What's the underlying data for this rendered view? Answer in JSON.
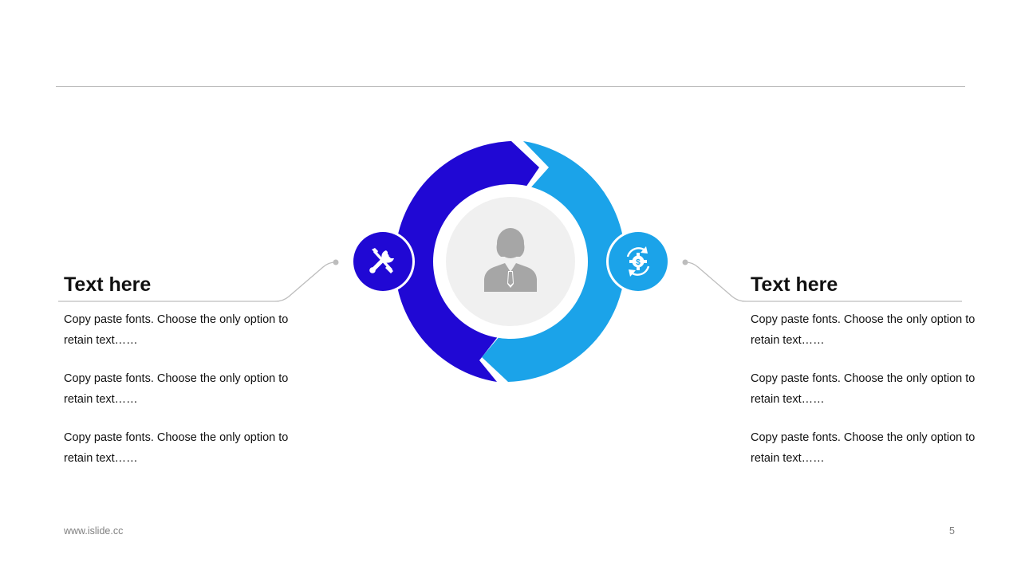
{
  "colors": {
    "dark_blue": "#2008d4",
    "light_blue": "#1ba3e9",
    "center_fill": "#f0f0f0",
    "person_icon": "#a6a6a6",
    "rule": "#bdbdbd"
  },
  "left_panel": {
    "title": "Text here",
    "paragraphs": [
      "Copy paste fonts. Choose the only option to retain text……",
      "Copy paste fonts. Choose the only option to retain text……",
      "Copy paste fonts. Choose the only option to retain text……"
    ],
    "icon": "tools-icon"
  },
  "right_panel": {
    "title": "Text here",
    "paragraphs": [
      "Copy paste fonts. Choose the only option to retain text……",
      "Copy paste fonts. Choose the only option to retain text……",
      "Copy paste fonts. Choose the only option to retain text……"
    ],
    "icon": "gear-refresh-icon"
  },
  "center_icon": "person-icon",
  "footer": {
    "url": "www.islide.cc",
    "page_number": "5"
  }
}
